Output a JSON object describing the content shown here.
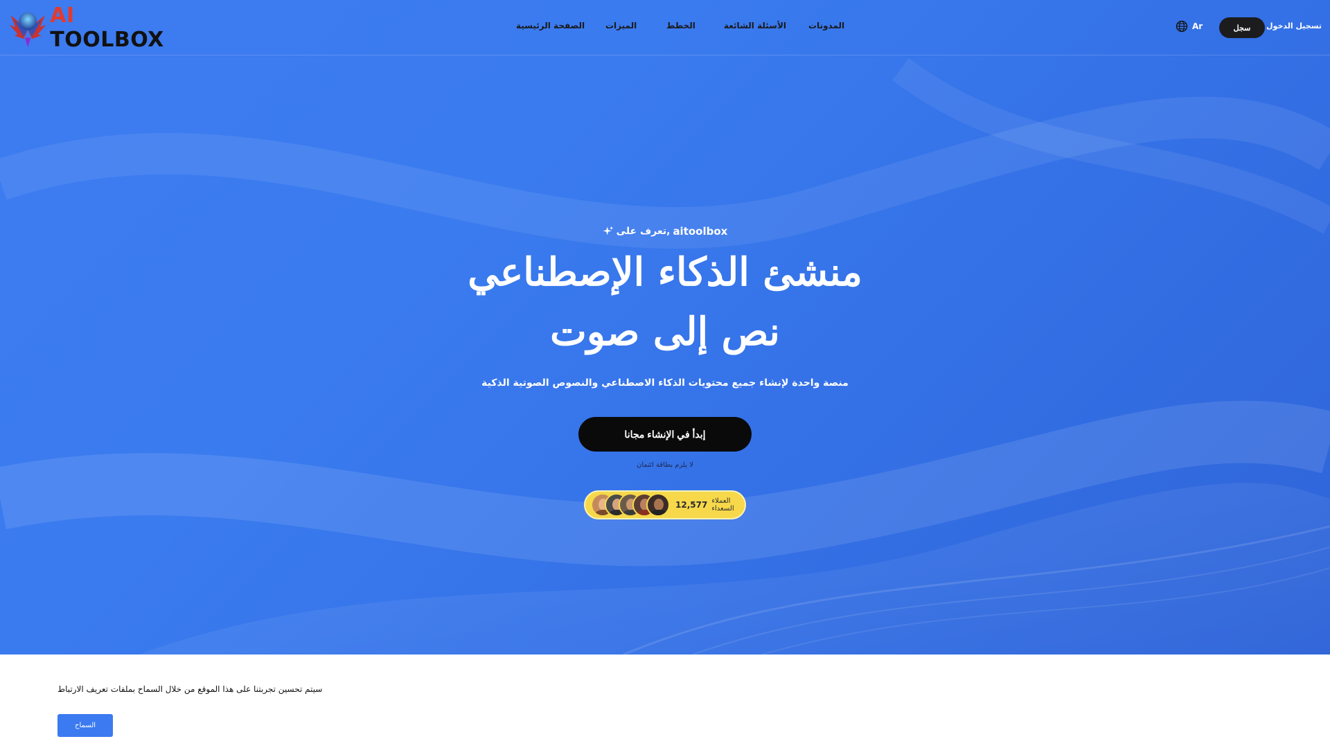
{
  "header": {
    "logo": {
      "prefix": "AI",
      "suffix": "TOOLBOX"
    },
    "nav": [
      {
        "id": "home",
        "label": "الصفحة الرئيسية"
      },
      {
        "id": "features",
        "label": "الميزات"
      },
      {
        "id": "plans",
        "label": "الخطط"
      },
      {
        "id": "faq",
        "label": "الأسئلة الشائعة"
      },
      {
        "id": "blogs",
        "label": "المدونات"
      }
    ],
    "language": {
      "label": "Ar",
      "icon": "globe-icon"
    },
    "signup_label": "سجل",
    "login_label": "تسجيل الدخول"
  },
  "hero": {
    "eyebrow_prefix": "تعرف على,",
    "eyebrow_brand": "aitoolbox",
    "eyebrow_icon": "sparkles-icon",
    "title_line1": "منشئ الذكاء الإصطناعي",
    "title_line2": "نص إلى صوت",
    "subtitle": "منصة واحدة لإنشاء جميع محتويات الذكاء الاصطناعي والنصوص الصوتية الذكية",
    "cta_label": "إبدأ في الإنشاء مجانا",
    "no_card_note": "لا يلزم بطاقة ائتمان",
    "customers": {
      "count": "12,577",
      "label": "العملاء السعداء"
    }
  },
  "cookie": {
    "message": "سيتم تحسين تجربتنا على هذا الموقع من خلال السماح بملفات تعريف الارتباط",
    "allow_label": "السماح"
  },
  "colors": {
    "hero_blue": "#3a7bef",
    "cta_black": "#0a0a0a",
    "pill_yellow": "#f6d84a",
    "cookie_button": "#3b7af0",
    "logo_red": "#e23b2e"
  }
}
